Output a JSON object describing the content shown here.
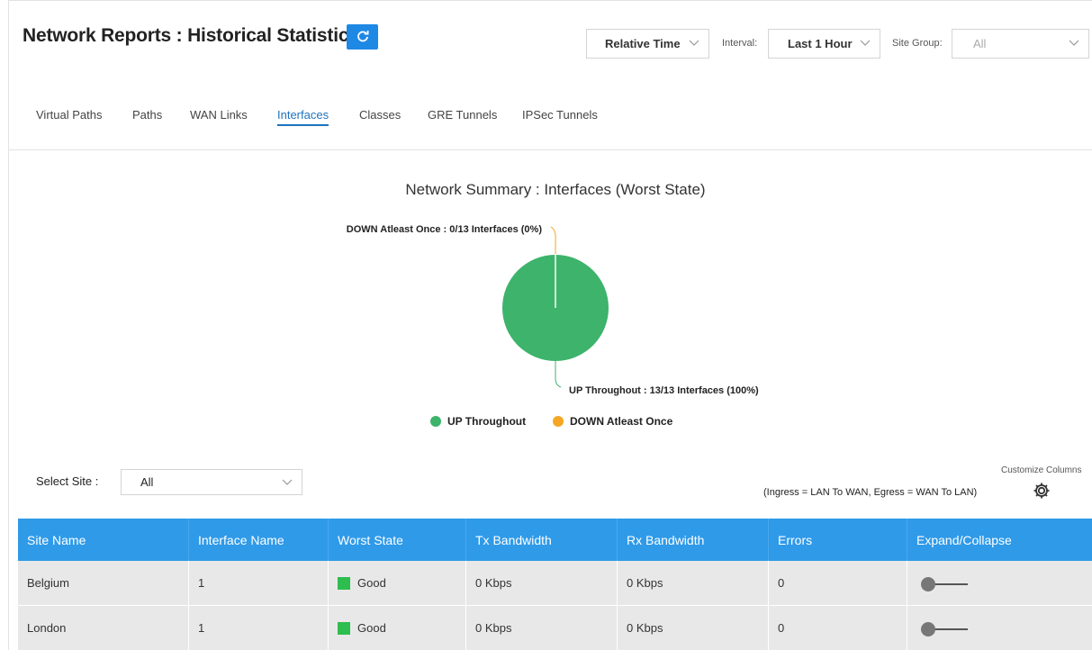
{
  "header": {
    "title": "Network Reports : Historical Statistics",
    "refresh_icon": "refresh-icon",
    "time_mode": "Relative Time",
    "interval_label": "Interval:",
    "interval_value": "Last 1 Hour",
    "site_group_label": "Site Group:",
    "site_group_value": "All"
  },
  "tabs": [
    {
      "label": "Virtual Paths",
      "active": false
    },
    {
      "label": "Paths",
      "active": false
    },
    {
      "label": "WAN Links",
      "active": false
    },
    {
      "label": "Interfaces",
      "active": true
    },
    {
      "label": "Classes",
      "active": false
    },
    {
      "label": "GRE Tunnels",
      "active": false
    },
    {
      "label": "IPSec Tunnels",
      "active": false
    }
  ],
  "chart_data": {
    "type": "pie",
    "title": "Network Summary : Interfaces (Worst State)",
    "slices": [
      {
        "name": "UP Throughout",
        "value": 13,
        "color": "#3db36b",
        "label": "UP Throughout : 13/13 Interfaces (100%)"
      },
      {
        "name": "DOWN Atleast Once",
        "value": 0,
        "color": "#f5a623",
        "label": "DOWN Atleast Once : 0/13 Interfaces (0%)"
      }
    ],
    "legend": {
      "placement": "bottom-center",
      "entries": [
        "UP Throughout",
        "DOWN Atleast Once"
      ]
    }
  },
  "filters": {
    "select_site_label": "Select Site :",
    "select_site_value": "All",
    "customize_label": "Customize Columns",
    "ingress_note": "(Ingress = LAN To WAN, Egress = WAN To LAN)"
  },
  "table": {
    "columns": [
      "Site Name",
      "Interface Name",
      "Worst State",
      "Tx Bandwidth",
      "Rx Bandwidth",
      "Errors",
      "Expand/Collapse"
    ],
    "rows": [
      {
        "site": "Belgium",
        "iface": "1",
        "state": "Good",
        "state_color": "#2ebd4f",
        "tx": "0 Kbps",
        "rx": "0 Kbps",
        "errors": "0"
      },
      {
        "site": "London",
        "iface": "1",
        "state": "Good",
        "state_color": "#2ebd4f",
        "tx": "0 Kbps",
        "rx": "0 Kbps",
        "errors": "0"
      }
    ]
  }
}
